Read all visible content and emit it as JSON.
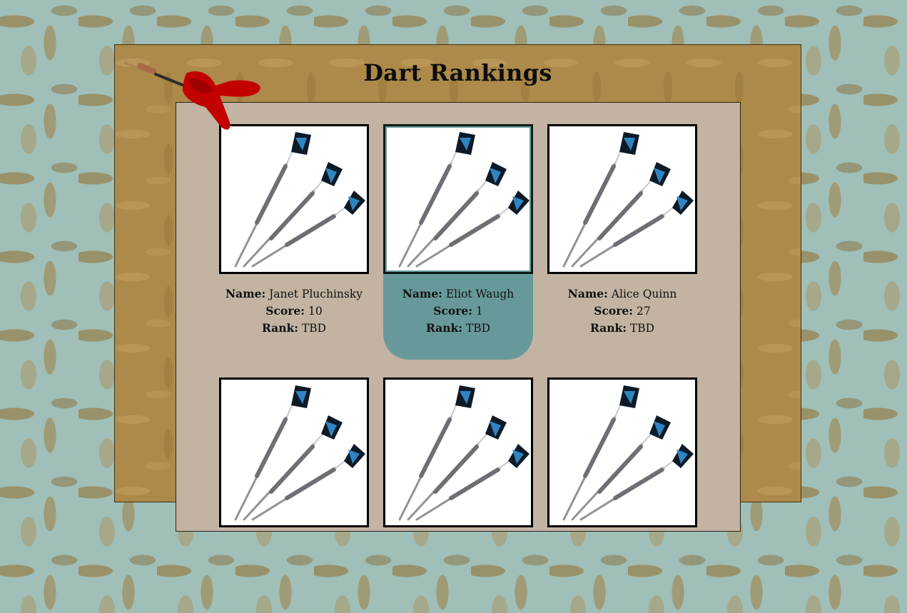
{
  "page": {
    "title": "Dart Rankings"
  },
  "labels": {
    "name": "Name:",
    "score": "Score:",
    "rank": "Rank:"
  },
  "players": [
    {
      "name": "Janet Pluchinsky",
      "score": "10",
      "rank": "TBD",
      "selected": false
    },
    {
      "name": "Eliot Waugh",
      "score": "1",
      "rank": "TBD",
      "selected": true
    },
    {
      "name": "Alice Quinn",
      "score": "27",
      "rank": "TBD",
      "selected": false
    },
    {
      "name": "",
      "score": "",
      "rank": "",
      "selected": false
    },
    {
      "name": "",
      "score": "",
      "rank": "",
      "selected": false
    },
    {
      "name": "",
      "score": "",
      "rank": "",
      "selected": false
    }
  ],
  "colors": {
    "selected_card": "#67999a",
    "panel": "#ad8a49",
    "content": "#c2b3a2"
  },
  "icons": {
    "player_image": "darts-icon",
    "decoration": "red-dart-icon"
  }
}
